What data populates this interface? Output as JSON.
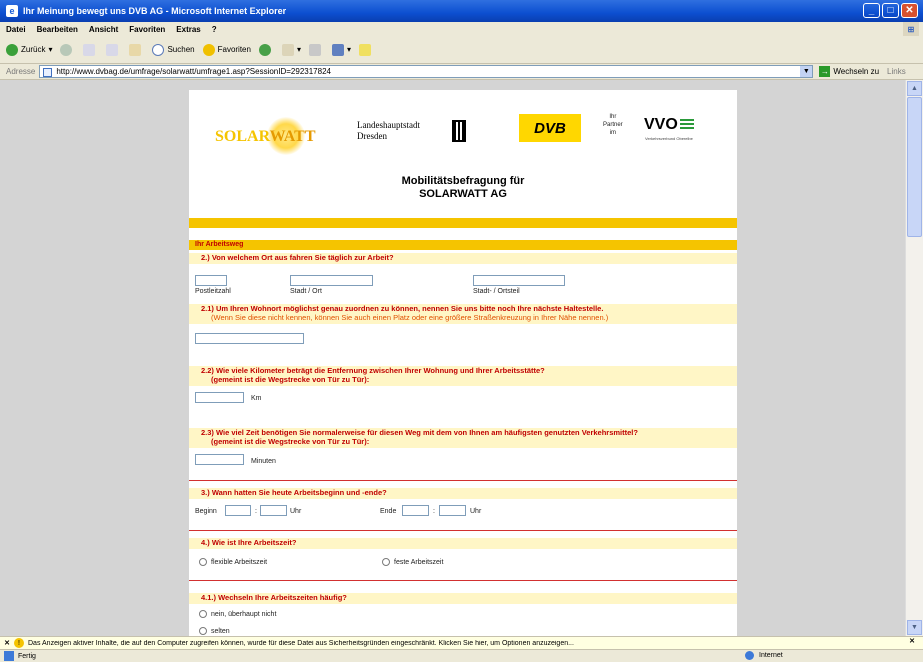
{
  "window": {
    "title": "Ihr Meinung bewegt uns DVB AG - Microsoft Internet Explorer"
  },
  "menubar": {
    "items": [
      "Datei",
      "Bearbeiten",
      "Ansicht",
      "Favoriten",
      "Extras",
      "?"
    ]
  },
  "toolbar": {
    "back": "Zurück",
    "search": "Suchen",
    "favorites": "Favoriten"
  },
  "address": {
    "label": "Adresse",
    "url": "http://www.dvbag.de/umfrage/solarwatt/umfrage1.asp?SessionID=292317824",
    "go": "Wechseln zu",
    "links": "Links"
  },
  "header": {
    "solar_a": "SOLAR",
    "solar_b": "WATT",
    "city_line1": "Landeshauptstadt",
    "city_line2": "Dresden",
    "dvb": "DVB",
    "partner_line1": "Ihr",
    "partner_line2": "Partner",
    "partner_line3": "im",
    "vvo": "VVO",
    "vvo_sub": "Verkehrsverbund Oberelbe"
  },
  "form": {
    "title_line1": "Mobilitätsbefragung für",
    "title_line2": "SOLARWATT AG",
    "section": "Ihr Arbeitsweg",
    "q2": "2.)  Von welchem Ort aus fahren Sie täglich zur Arbeit?",
    "postleitzahl": "Postleitzahl",
    "stadt_ort": "Stadt / Ort",
    "stadt_ortsteil": "Stadt- / Ortsteil",
    "q21": "2.1) Um Ihren Wohnort möglichst genau zuordnen zu können, nennen Sie uns bitte noch Ihre nächste Haltestelle.",
    "q21_note": "(Wenn Sie diese nicht kennen, können Sie auch einen Platz oder eine größere Straßenkreuzung in Ihrer Nähe nennen.)",
    "q22": "2.2) Wie viele Kilometer beträgt die Entfernung zwischen Ihrer Wohnung und Ihrer Arbeitsstätte?",
    "q22_sub": "(gemeint ist die Wegstrecke von Tür zu Tür):",
    "km": "Km",
    "q23": "2.3) Wie viel Zeit benötigen Sie normalerweise für diesen Weg mit dem von Ihnen am häufigsten genutzten Verkehrsmittel?",
    "q23_sub": "(gemeint ist die Wegstrecke von Tür zu Tür):",
    "minuten": "Minuten",
    "q3": "3.)  Wann hatten Sie heute Arbeitsbeginn und -ende?",
    "beginn": "Beginn",
    "colon": ":",
    "uhr": "Uhr",
    "ende": "Ende",
    "q4": "4.)  Wie ist Ihre Arbeitszeit?",
    "flex": "flexible Arbeitszeit",
    "fest": "feste Arbeitszeit",
    "q41": "4.1.) Wechseln Ihre Arbeitszeiten häufig?",
    "nein": "nein, überhaupt nicht",
    "selten": "selten"
  },
  "infobar": {
    "text": "Das Anzeigen aktiver Inhalte, die auf den Computer zugreifen können, wurde für diese Datei aus Sicherheitsgründen eingeschränkt. Klicken Sie hier, um Optionen anzuzeigen..."
  },
  "status": {
    "text": "Fertig",
    "zone": "Internet"
  }
}
